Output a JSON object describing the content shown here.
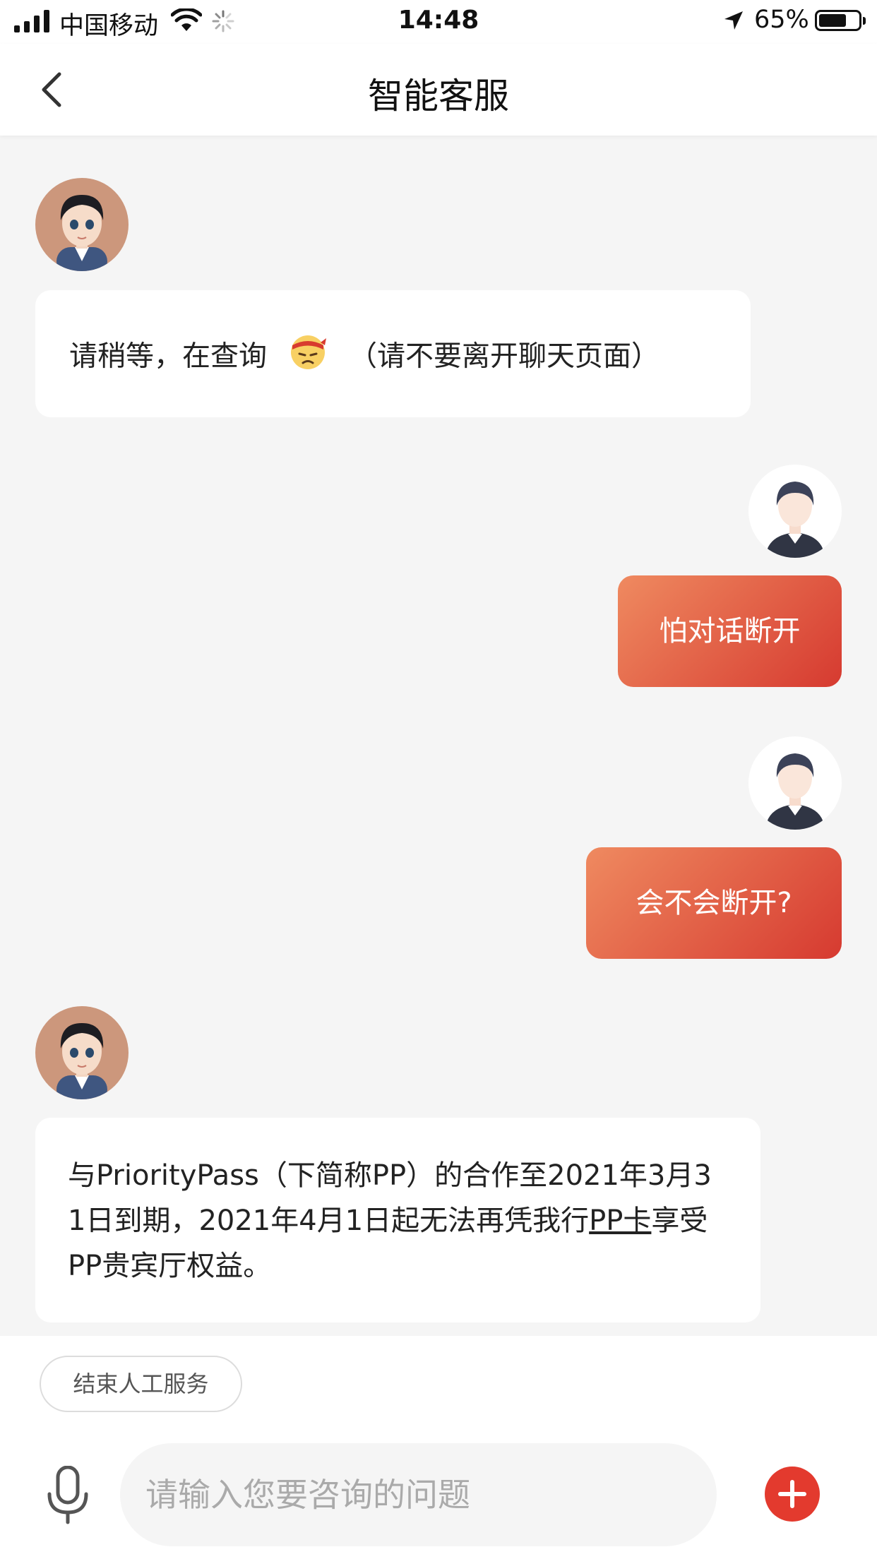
{
  "status_bar": {
    "carrier": "中国移动",
    "time": "14:48",
    "battery_percent": "65%"
  },
  "nav": {
    "title": "智能客服",
    "back_icon": "chevron-left-icon"
  },
  "messages": [
    {
      "sender": "agent",
      "text_before": "请稍等，在查询",
      "emoji": "annoyed-headband-emoji",
      "text_after": "（请不要离开聊天页面）"
    },
    {
      "sender": "user",
      "text": "怕对话断开"
    },
    {
      "sender": "user",
      "text": "会不会断开?"
    },
    {
      "sender": "agent",
      "line1": "与PriorityPass（下简称PP）的合作至2021年3月3",
      "line2_pre": "1日到期，2021年4月1日起无法再凭我行",
      "line2_link": "PP卡",
      "line2_post": "享受",
      "line3": "PP贵宾厅权益。"
    }
  ],
  "quick_actions": {
    "end_service": "结束人工服务"
  },
  "composer": {
    "placeholder": "请输入您要咨询的问题",
    "mic_icon": "microphone-icon",
    "plus_icon": "plus-icon"
  },
  "colors": {
    "accent": "#e33a2e",
    "user_bubble_start": "#ef8a60",
    "user_bubble_end": "#d63a30",
    "background": "#f5f5f5"
  }
}
